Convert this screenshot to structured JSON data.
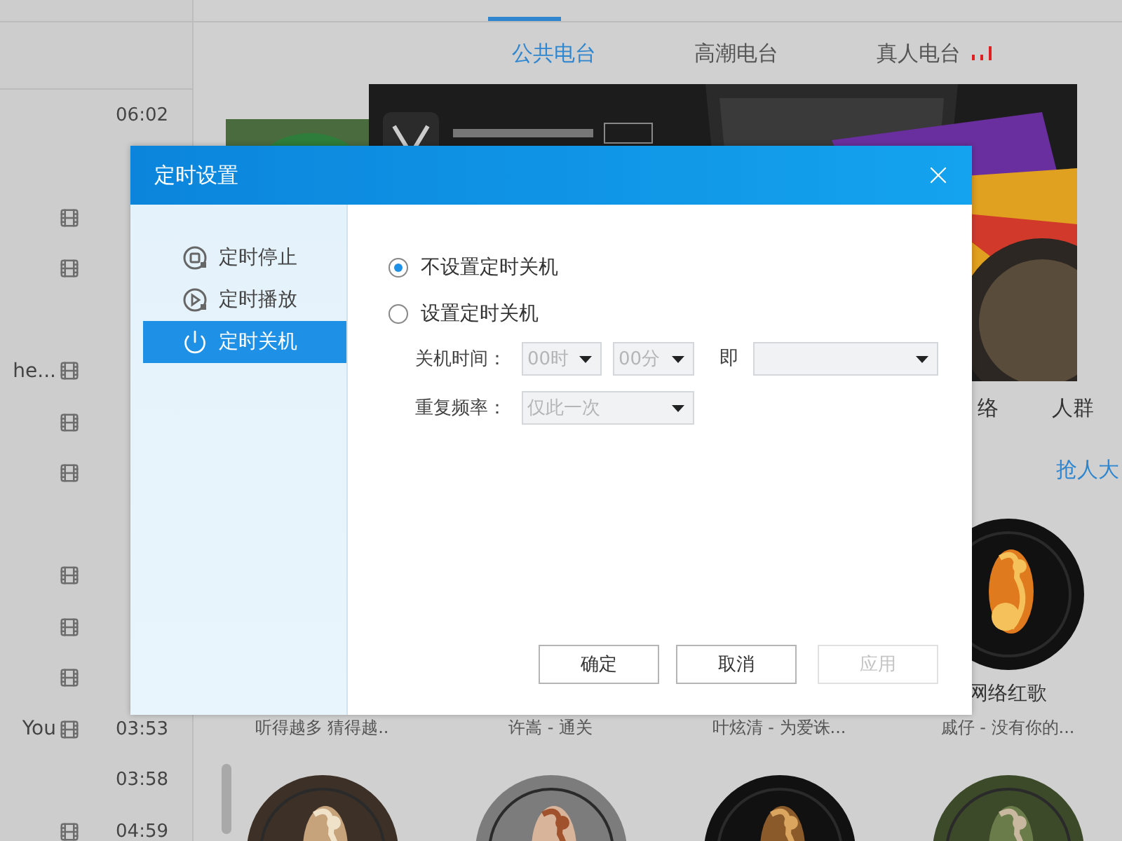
{
  "top_tabs": [
    {
      "selected": false
    },
    {
      "selected": true
    },
    {
      "selected": false
    },
    {
      "selected": false
    }
  ],
  "song_list": [
    {
      "video": false,
      "duration": "06:02"
    },
    {
      "video": false
    },
    {
      "video": true
    },
    {
      "video": true
    },
    {
      "video": false
    },
    {
      "title": "he...",
      "video": true
    },
    {
      "video": true
    },
    {
      "video": true
    },
    {
      "video": false
    },
    {
      "video": true
    },
    {
      "video": true
    },
    {
      "video": true
    },
    {
      "title": "You",
      "video": true,
      "duration": "03:53"
    },
    {
      "video": false,
      "duration": "03:58"
    },
    {
      "video": true,
      "duration": "04:59"
    }
  ],
  "radio_tabs": [
    {
      "label": "公共电台",
      "selected": true
    },
    {
      "label": "高潮电台",
      "selected": false
    },
    {
      "label": "真人电台",
      "selected": false,
      "live": true
    }
  ],
  "category_tabs": [
    {
      "label": "络"
    },
    {
      "label": "人群"
    }
  ],
  "more_link": "抢人大",
  "cards": [
    {
      "caption": "听得越多 猜得越.."
    },
    {
      "caption": "许嵩 - 通关"
    },
    {
      "caption": "叶炫清 - 为爱诛..."
    },
    {
      "title": "网络红歌",
      "caption": "戚仔 - 没有你的..."
    }
  ],
  "dialog": {
    "title": "定时设置",
    "menu": [
      {
        "label": "定时停止",
        "kind": "stop",
        "selected": false
      },
      {
        "label": "定时播放",
        "kind": "play",
        "selected": false
      },
      {
        "label": "定时关机",
        "kind": "power",
        "selected": true
      }
    ],
    "options": [
      {
        "label": "不设置定时关机",
        "selected": true
      },
      {
        "label": "设置定时关机",
        "selected": false
      }
    ],
    "shutdown_time": {
      "label": "关机时间：",
      "hour": "00时",
      "minute": "00分",
      "joiner": "即",
      "disabled": true
    },
    "repeat": {
      "label": "重复频率：",
      "value": "仅此一次",
      "disabled": true
    },
    "buttons": [
      {
        "label": "确定",
        "disabled": false
      },
      {
        "label": "取消",
        "disabled": false
      },
      {
        "label": "应用",
        "disabled": true
      }
    ]
  }
}
